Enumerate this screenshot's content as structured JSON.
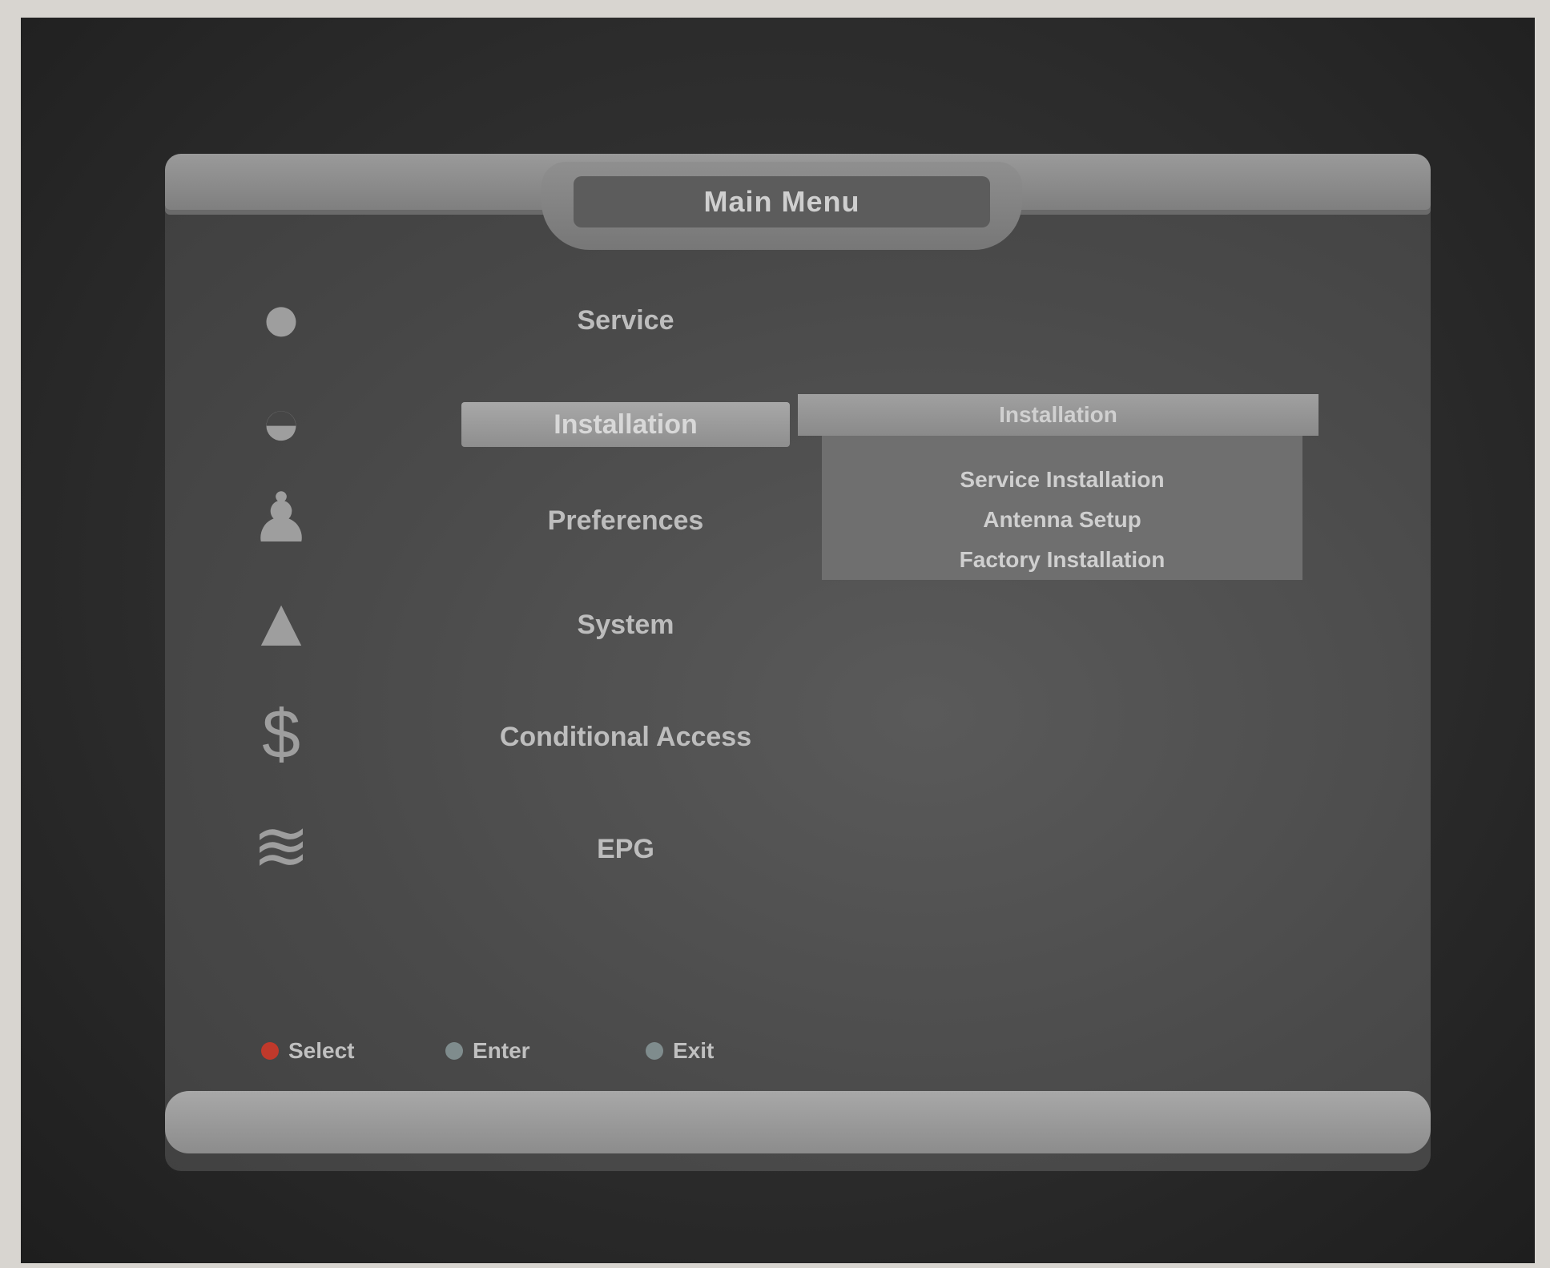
{
  "window": {
    "title": "Main Menu"
  },
  "menu": {
    "items": [
      {
        "label": "Service",
        "icon": "globe-icon",
        "glyph": "●"
      },
      {
        "label": "Installation",
        "icon": "satellite-dish-icon",
        "glyph": "◒"
      },
      {
        "label": "Preferences",
        "icon": "preferences-icon",
        "glyph": "♟"
      },
      {
        "label": "System",
        "icon": "system-icon",
        "glyph": "▲"
      },
      {
        "label": "Conditional Access",
        "icon": "conditional-access-icon",
        "glyph": "$"
      },
      {
        "label": "EPG",
        "icon": "epg-icon",
        "glyph": "≋"
      }
    ],
    "selected_index": 1
  },
  "popup": {
    "header": "Installation",
    "options": [
      "Service Installation",
      "Antenna Setup",
      "Factory Installation"
    ]
  },
  "footer": {
    "hints": [
      {
        "label": "Select",
        "color": "#c0392b",
        "icon": "red-button-icon"
      },
      {
        "label": "Enter",
        "color": "#7f8c8d",
        "icon": "ok-button-icon"
      },
      {
        "label": "Exit",
        "color": "#7f8c8d",
        "icon": "exit-button-icon"
      }
    ]
  }
}
